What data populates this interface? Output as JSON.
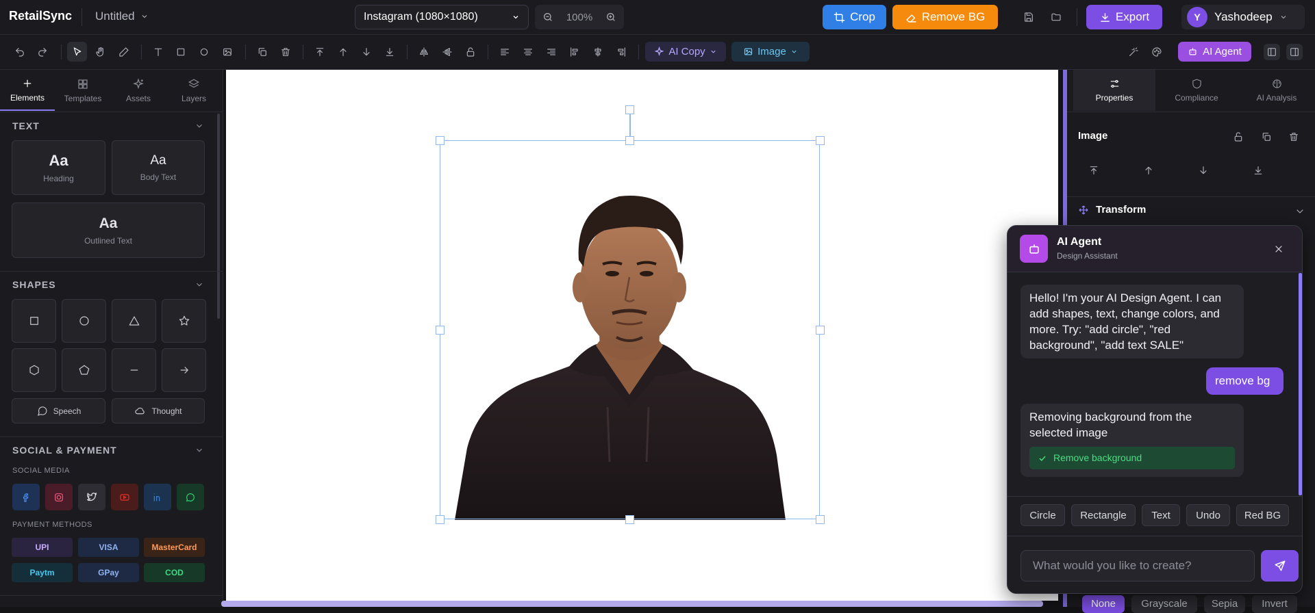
{
  "app": {
    "name": "RetailSync",
    "doc_title": "Untitled",
    "size_preset": "Instagram (1080×1080)",
    "zoom": "100%",
    "user_initial": "Y",
    "user_name": "Yashodeep"
  },
  "actions": {
    "crop": "Crop",
    "remove_bg": "Remove BG",
    "export": "Export",
    "ai_copy": "AI Copy",
    "image": "Image",
    "ai_agent": "AI Agent"
  },
  "colors": {
    "accent": "#8b7cf6",
    "crop": "#2f7fe6",
    "remove_bg": "#f68a0c",
    "export": "#7c4ee4",
    "ai_agent": "#9a4fe0",
    "selection": "#8fb8ee"
  },
  "left_tabs": [
    {
      "label": "Elements",
      "icon": "plus-icon"
    },
    {
      "label": "Templates",
      "icon": "grid-icon"
    },
    {
      "label": "Assets",
      "icon": "sparkles-icon"
    },
    {
      "label": "Layers",
      "icon": "layers-icon"
    }
  ],
  "text_section": {
    "title": "TEXT",
    "heading": {
      "glyph": "Aa",
      "label": "Heading"
    },
    "body": {
      "glyph": "Aa",
      "label": "Body Text"
    },
    "outlined": {
      "glyph": "Aa",
      "label": "Outlined Text"
    }
  },
  "shapes_section": {
    "title": "SHAPES",
    "speech": "Speech",
    "thought": "Thought"
  },
  "social_section": {
    "title": "SOCIAL & PAYMENT",
    "social_label": "SOCIAL MEDIA",
    "payment_label": "PAYMENT METHODS"
  },
  "payments": [
    "UPI",
    "VISA",
    "MasterCard",
    "Paytm",
    "GPay",
    "COD"
  ],
  "right_tabs": [
    {
      "label": "Properties",
      "icon": "sliders-icon"
    },
    {
      "label": "Compliance",
      "icon": "shield-icon"
    },
    {
      "label": "AI Analysis",
      "icon": "brain-icon"
    }
  ],
  "properties": {
    "section_title": "Image",
    "transform_title": "Transform"
  },
  "chat": {
    "title": "AI Agent",
    "subtitle": "Design Assistant",
    "messages": [
      "Hello! I'm your AI Design Agent. I can add shapes, text, change colors, and more. Try: \"add circle\", \"red background\", \"add text SALE\"",
      "remove bg",
      "Removing background from the selected image"
    ],
    "action_chip": "Remove background",
    "suggestions": [
      "Circle",
      "Rectangle",
      "Text",
      "Undo",
      "Red BG"
    ],
    "input_placeholder": "What would you like to create?"
  },
  "filters": [
    "None",
    "Grayscale",
    "Sepia",
    "Invert"
  ]
}
